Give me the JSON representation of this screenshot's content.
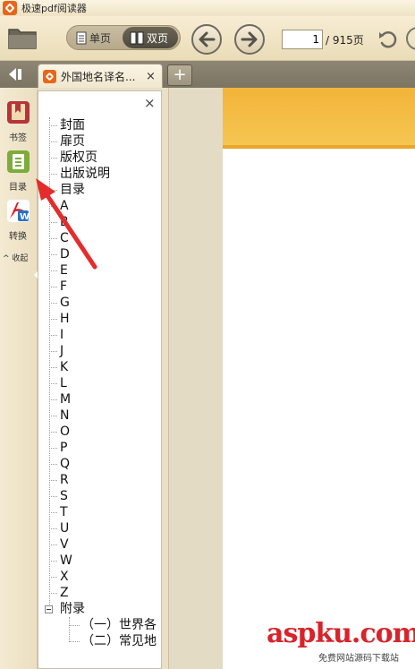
{
  "window": {
    "title": "极速pdf阅读器"
  },
  "toolbar": {
    "single_page_label": "单页",
    "double_page_label": "双页",
    "current_page": "1",
    "page_total": "/ 915页"
  },
  "tabs": [
    {
      "label": "外国地名译名..."
    }
  ],
  "tab_close_glyph": "×",
  "new_tab_glyph": "+",
  "sidebar": {
    "items": [
      {
        "label": "书签",
        "icon": "bookmark-icon"
      },
      {
        "label": "目录",
        "icon": "toc-icon"
      },
      {
        "label": "转换",
        "icon": "convert-icon"
      }
    ],
    "collapse_label": "收起",
    "collapse_glyph": "^"
  },
  "toc": {
    "close_glyph": "×",
    "items": [
      "封面",
      "扉页",
      "版权页",
      "出版说明",
      "目录",
      "A",
      "B",
      "C",
      "D",
      "E",
      "F",
      "G",
      "H",
      "I",
      "J",
      "K",
      "L",
      "M",
      "N",
      "O",
      "P",
      "Q",
      "R",
      "S",
      "T",
      "U",
      "V",
      "W",
      "X",
      "Z"
    ],
    "appendix": {
      "label": "附录",
      "children": [
        "（一）世界各",
        "（二）常见地"
      ]
    }
  },
  "watermark": {
    "main": "aspku.com",
    "sub": "免费网站源码下载站"
  },
  "colors": {
    "accent_orange": "#e8661a",
    "annotation_red": "#e52b2b",
    "cover_yellow": "#f3b43a"
  }
}
